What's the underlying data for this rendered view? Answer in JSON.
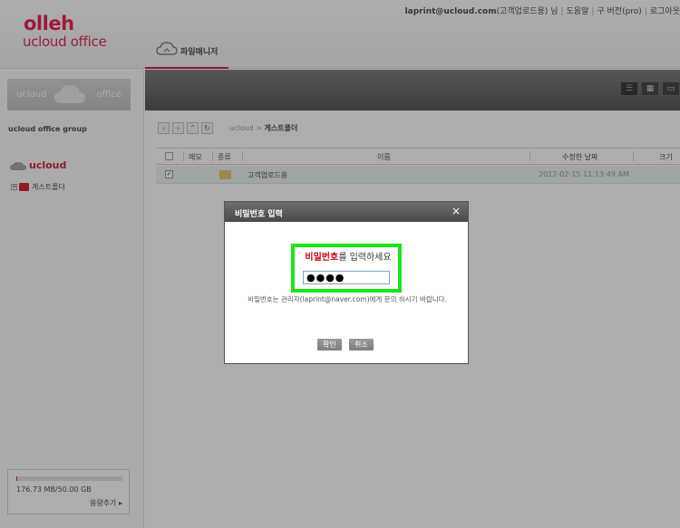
{
  "header": {
    "logo_top": "olleh",
    "logo_bottom": "ucloud office",
    "user_email": "laprint@ucloud.com",
    "user_name": "(고객업로드용) 님",
    "links": [
      "도움말",
      "구 버전(pro)",
      "로그아웃"
    ]
  },
  "tabs": [
    {
      "label": "파일매니저",
      "active": true
    }
  ],
  "sidebar": {
    "banner_left": "ucloud",
    "banner_right": "office",
    "group_name": "ucloud office group",
    "brand": "ucloud",
    "tree": [
      {
        "label": "게스트폴더",
        "expand": "+"
      }
    ],
    "storage": {
      "used": "176.73 MB/50.00 GB",
      "fraction": 0.0035,
      "add_label": "용량추가"
    }
  },
  "toolbar": {
    "views": [
      "list",
      "grid",
      "preview"
    ],
    "active_view": "list"
  },
  "breadcrumb": {
    "root": "ucloud",
    "separator": ">",
    "current": "게스트폴더"
  },
  "file_list": {
    "columns": [
      "메모",
      "종류",
      "이름",
      "수정한 날짜",
      "크기"
    ],
    "rows": [
      {
        "checked": true,
        "name": "고객업로드용",
        "modified": "2012-02-15 11:13:49 AM",
        "size": ""
      }
    ]
  },
  "dialog": {
    "title": "비밀번호 입력",
    "close": "×",
    "prompt_highlight": "비밀번호",
    "prompt_rest": "를 입력하세요",
    "password_mask": "●●●●",
    "help": "비밀번호는 관리자(laprint@naver.com)에게 문의 하시기 바랍니다.",
    "confirm": "확인",
    "cancel": "취소"
  },
  "colors": {
    "brand_red": "#d0021b",
    "highlight_green": "#1be51b",
    "toolbar_dark": "#4a4a4a"
  }
}
